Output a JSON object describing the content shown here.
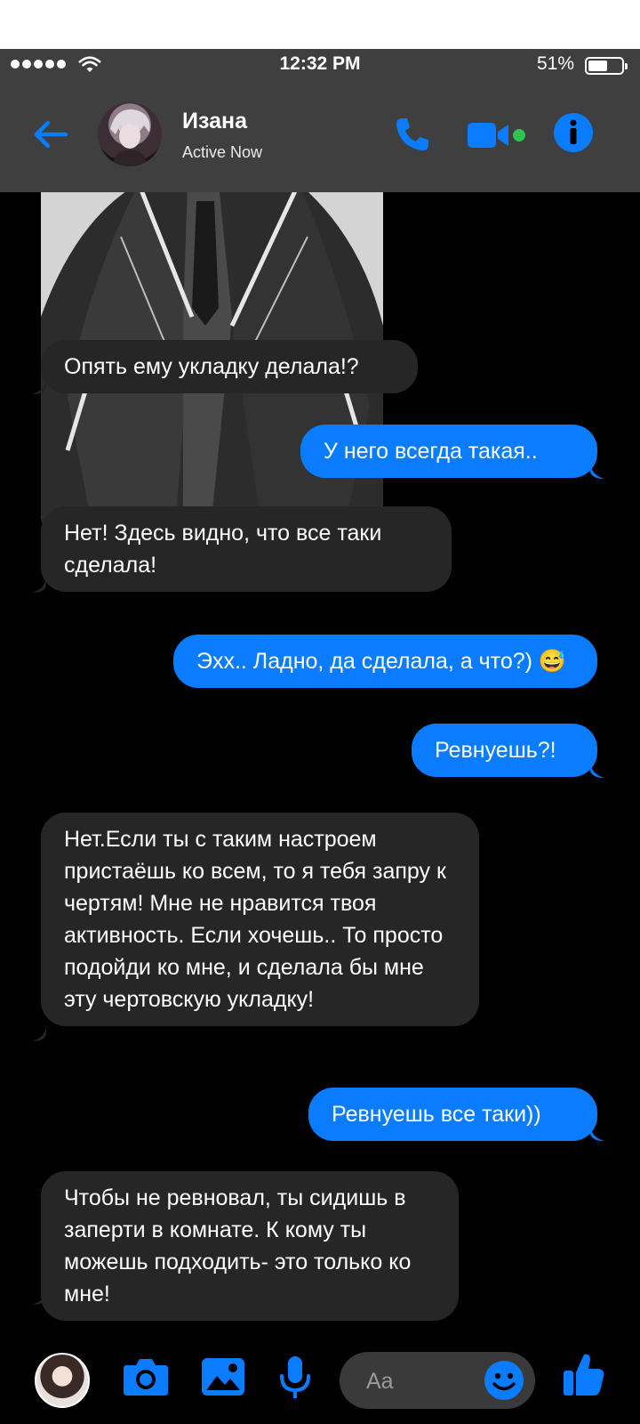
{
  "status_bar": {
    "time": "12:32 PM",
    "battery": "51%"
  },
  "header": {
    "contact_name": "Изана",
    "status": "Active Now"
  },
  "messages": [
    {
      "side": "in",
      "text": "Опять ему укладку делала!?"
    },
    {
      "side": "out",
      "text": "У него всегда такая.."
    },
    {
      "side": "in",
      "text": "Нет! Здесь видно, что все таки сделала!"
    },
    {
      "side": "out",
      "text": "Эхх.. Ладно, да сделала, а что?) 😅"
    },
    {
      "side": "out",
      "text": "Ревнуешь?!"
    },
    {
      "side": "in",
      "text": "Нет.Если ты с таким настроем пристаёшь ко всем, то я тебя запру к чертям! Мне не нравится твоя активность. Если хочешь.. То просто подойди ко мне, и сделала бы мне эту чертовскую укладку!"
    },
    {
      "side": "out",
      "text": "Ревнуешь все таки))"
    },
    {
      "side": "in",
      "text": "Чтобы не ревновал, ты сидишь в заперти в комнате. К кому ты можешь подходить- это только ко мне!"
    }
  ],
  "composer": {
    "placeholder": "Aa"
  },
  "colors": {
    "accent": "#0a7cff",
    "incoming_bubble": "#262626",
    "header_bg": "#3f3f3f",
    "online_dot": "#31c24d"
  },
  "icons": [
    "back-arrow-icon",
    "phone-icon",
    "video-icon",
    "info-icon",
    "camera-icon",
    "image-icon",
    "microphone-icon",
    "emoji-icon",
    "thumbs-up-icon"
  ]
}
